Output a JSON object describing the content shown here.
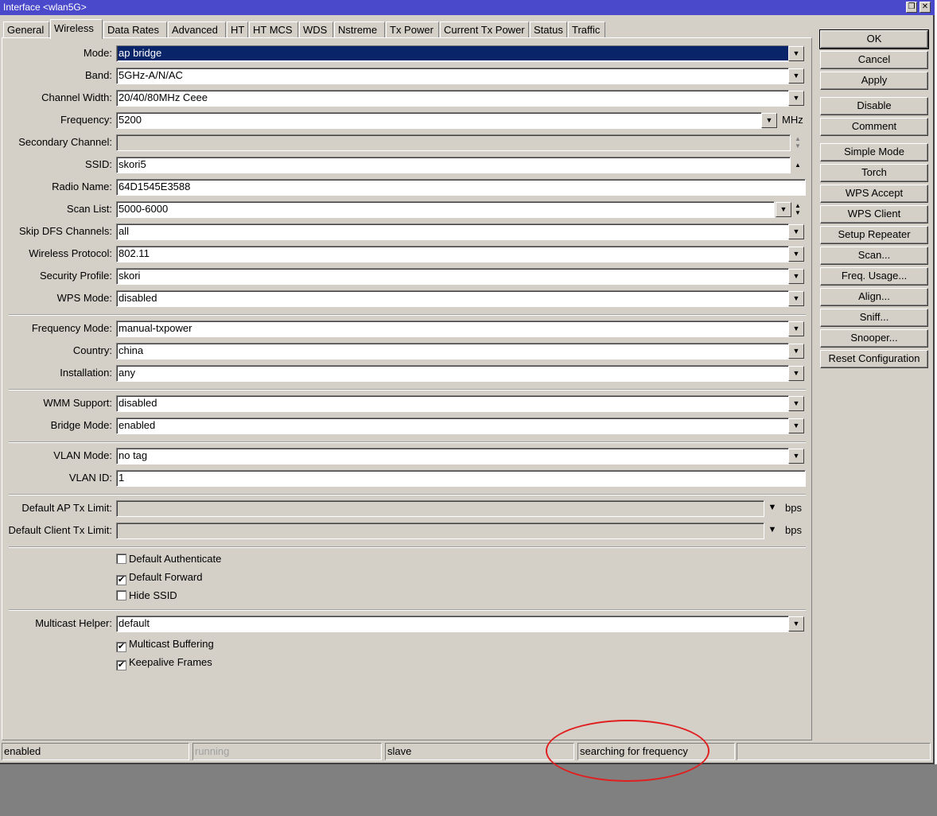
{
  "window": {
    "title": "Interface <wlan5G>",
    "restore_icon": "restore-icon",
    "close_icon": "close-icon"
  },
  "tabs": [
    "General",
    "Wireless",
    "Data Rates",
    "Advanced",
    "HT",
    "HT MCS",
    "WDS",
    "Nstreme",
    "Tx Power",
    "Current Tx Power",
    "Status",
    "Traffic"
  ],
  "active_tab": "Wireless",
  "form": {
    "mode": {
      "label": "Mode:",
      "value": "ap bridge"
    },
    "band": {
      "label": "Band:",
      "value": "5GHz-A/N/AC"
    },
    "channel_width": {
      "label": "Channel Width:",
      "value": "20/40/80MHz Ceee"
    },
    "frequency": {
      "label": "Frequency:",
      "value": "5200",
      "unit": "MHz"
    },
    "secondary_channel": {
      "label": "Secondary Channel:",
      "value": ""
    },
    "ssid": {
      "label": "SSID:",
      "value": "skori5"
    },
    "radio_name": {
      "label": "Radio Name:",
      "value": "64D1545E3588"
    },
    "scan_list": {
      "label": "Scan List:",
      "value": "5000-6000"
    },
    "skip_dfs": {
      "label": "Skip DFS Channels:",
      "value": "all"
    },
    "wireless_protocol": {
      "label": "Wireless Protocol:",
      "value": "802.11"
    },
    "security_profile": {
      "label": "Security Profile:",
      "value": "skori"
    },
    "wps_mode": {
      "label": "WPS Mode:",
      "value": "disabled"
    },
    "frequency_mode": {
      "label": "Frequency Mode:",
      "value": "manual-txpower"
    },
    "country": {
      "label": "Country:",
      "value": "china"
    },
    "installation": {
      "label": "Installation:",
      "value": "any"
    },
    "wmm_support": {
      "label": "WMM Support:",
      "value": "disabled"
    },
    "bridge_mode": {
      "label": "Bridge Mode:",
      "value": "enabled"
    },
    "vlan_mode": {
      "label": "VLAN Mode:",
      "value": "no tag"
    },
    "vlan_id": {
      "label": "VLAN ID:",
      "value": "1"
    },
    "default_ap_tx_limit": {
      "label": "Default AP Tx Limit:",
      "value": "",
      "unit": "bps"
    },
    "default_client_tx_limit": {
      "label": "Default Client Tx Limit:",
      "value": "",
      "unit": "bps"
    },
    "default_authenticate": {
      "label": "Default Authenticate",
      "checked": false
    },
    "default_forward": {
      "label": "Default Forward",
      "checked": true
    },
    "hide_ssid": {
      "label": "Hide SSID",
      "checked": false
    },
    "multicast_helper": {
      "label": "Multicast Helper:",
      "value": "default"
    },
    "multicast_buffering": {
      "label": "Multicast Buffering",
      "checked": true
    },
    "keepalive_frames": {
      "label": "Keepalive Frames",
      "checked": true
    }
  },
  "buttons": [
    "OK",
    "Cancel",
    "Apply",
    "Disable",
    "Comment",
    "Simple Mode",
    "Torch",
    "WPS Accept",
    "WPS Client",
    "Setup Repeater",
    "Scan...",
    "Freq. Usage...",
    "Align...",
    "Sniff...",
    "Snooper...",
    "Reset Configuration"
  ],
  "status_bar": [
    "enabled",
    "running",
    "slave",
    "searching for frequency",
    ""
  ],
  "annotation_color": "#e02020",
  "check_glyph": "✔"
}
